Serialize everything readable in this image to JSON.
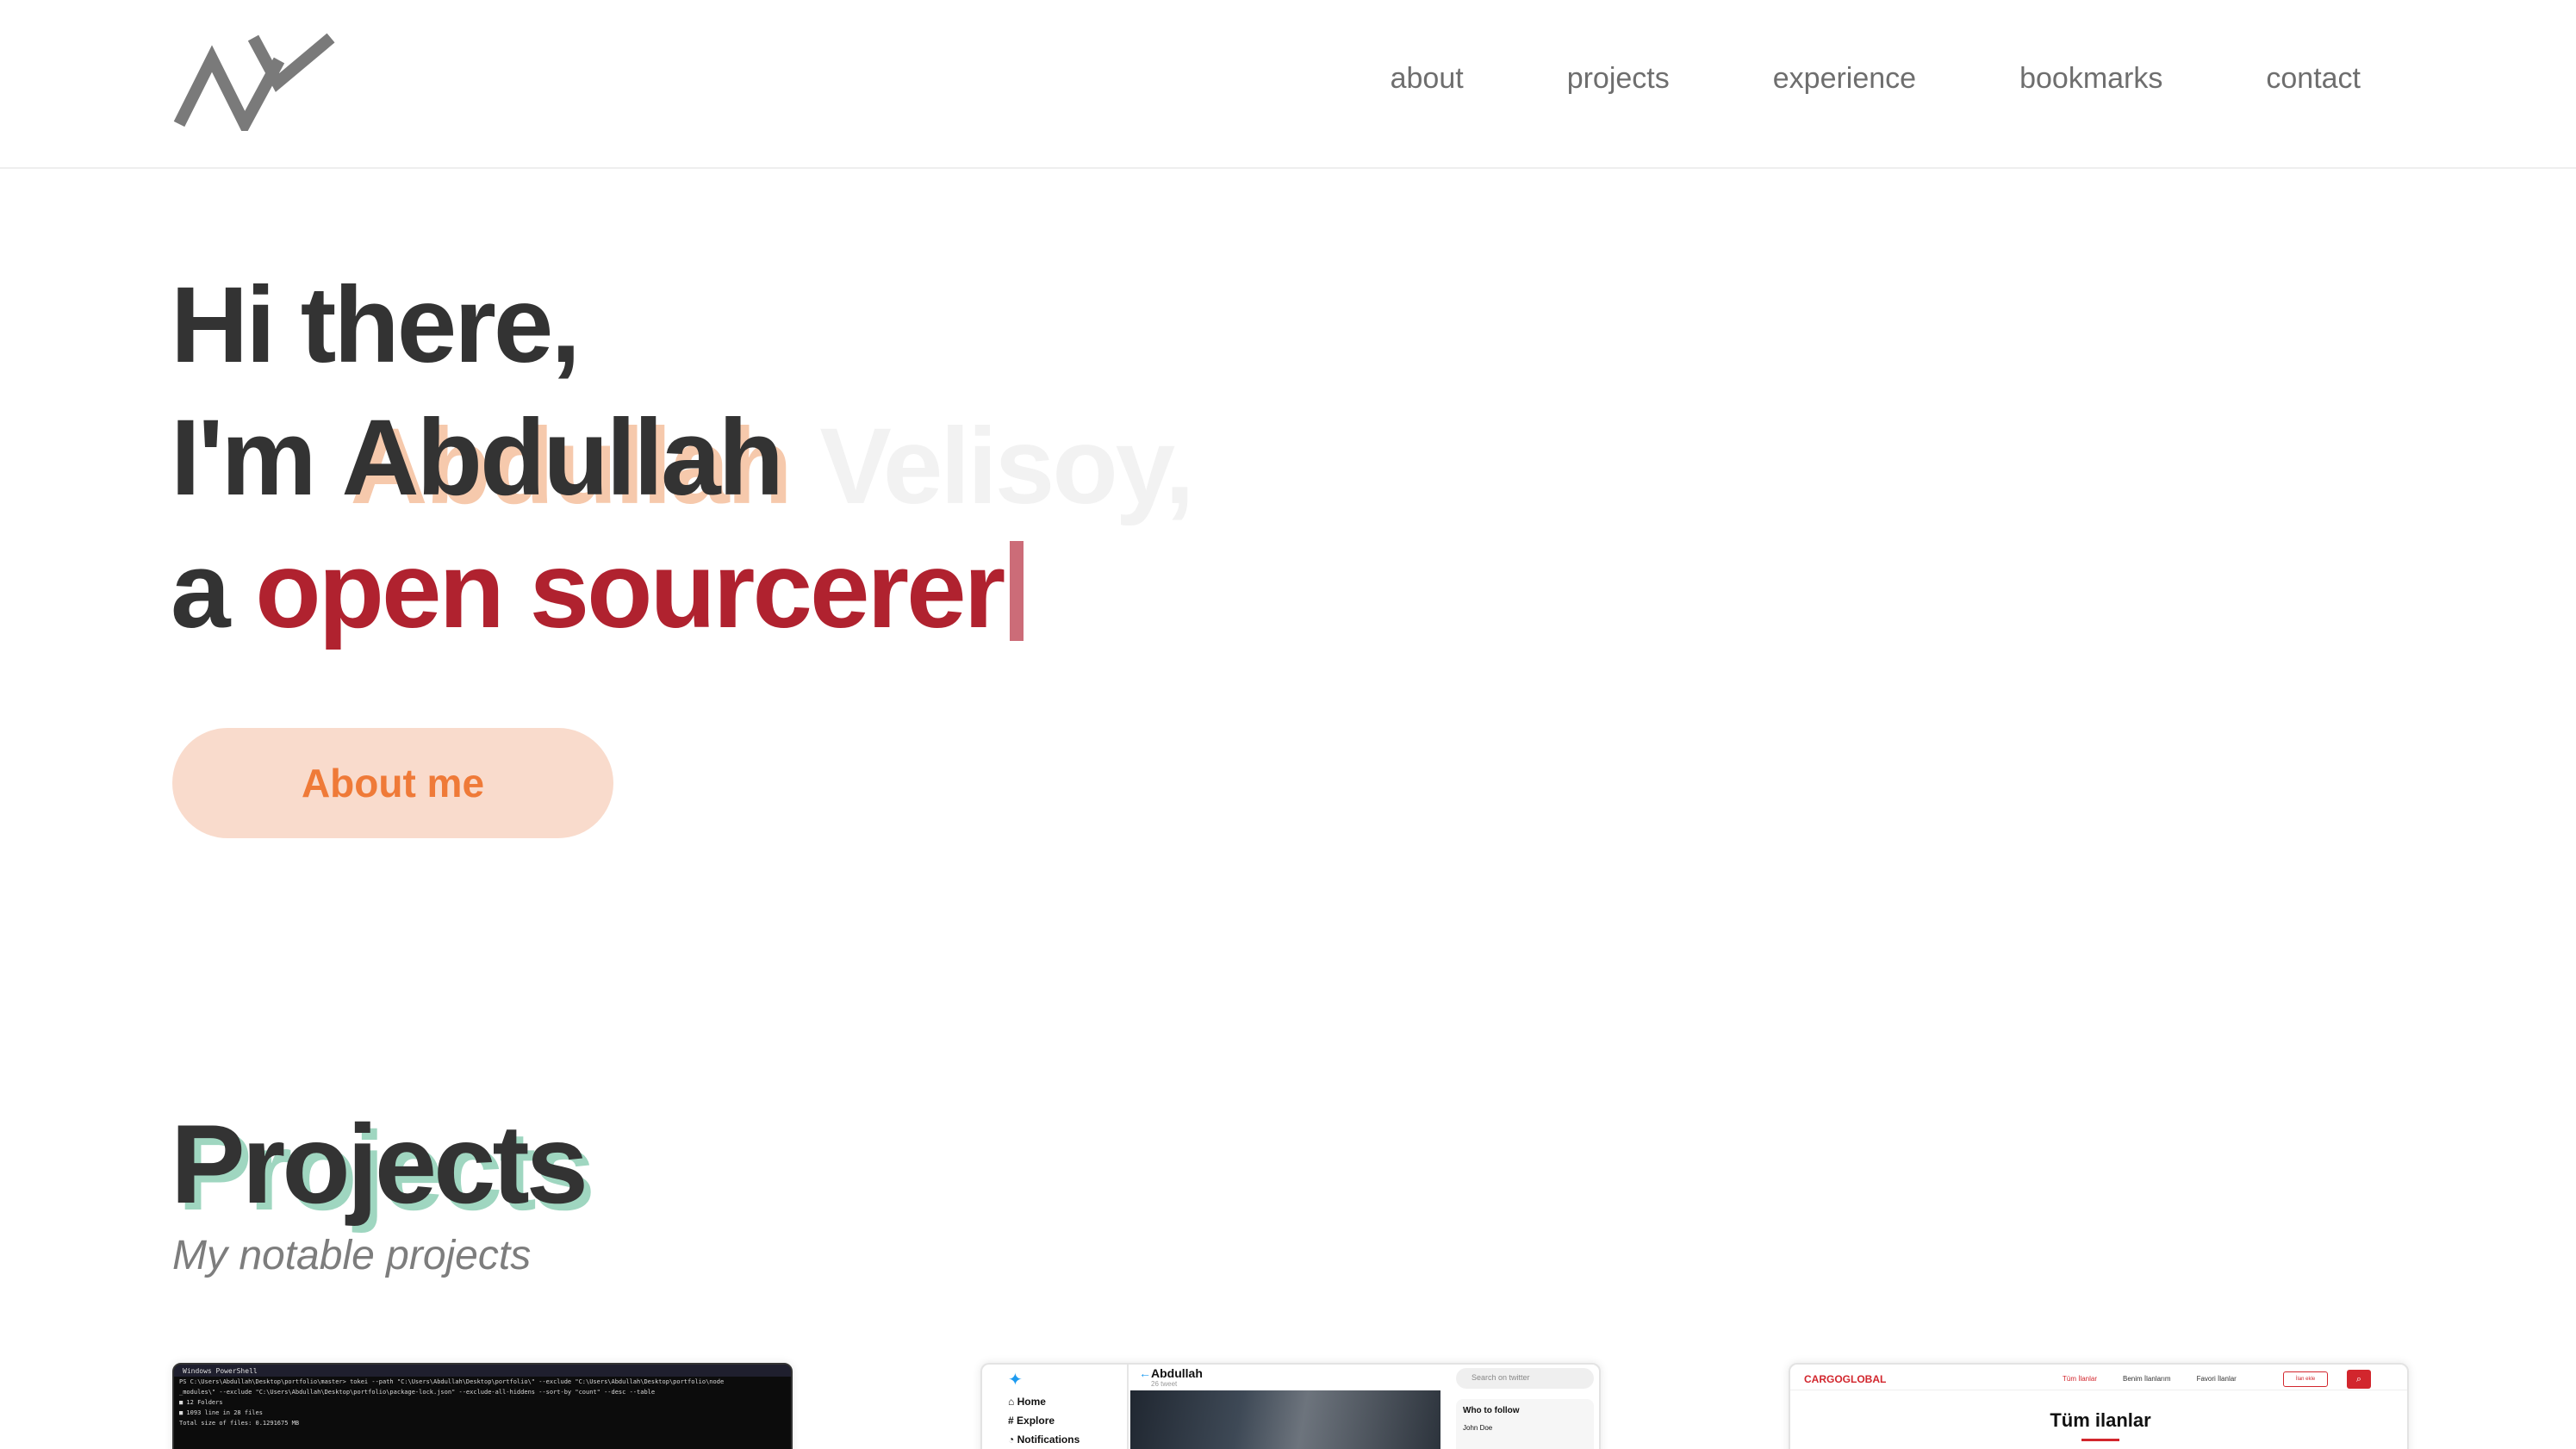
{
  "header": {
    "logo_name": "AV monogram logo",
    "nav": [
      "about",
      "projects",
      "experience",
      "bookmarks",
      "contact"
    ]
  },
  "hero": {
    "greeting": "Hi there,",
    "im": "I'm",
    "first_name": "Abdullah",
    "last_name": "Velisoy,",
    "article": "a",
    "role": "open sourcerer",
    "about_button": "About me"
  },
  "projects": {
    "title": "Projects",
    "subtitle": "My notable projects",
    "cards": [
      {
        "terminal_title": "Windows PowerShell",
        "lines": [
          "PS C:\\Users\\Abdullah\\Desktop\\portfolio\\master> tokei --path \"C:\\Users\\Abdullah\\Desktop\\portfolio\\\" --exclude \"C:\\Users\\Abdullah\\Desktop\\portfolio\\node",
          "_modules\\\" --exclude \"C:\\Users\\Abdullah\\Desktop\\portfolio\\package-lock.json\" --exclude-all-hiddens --sort-by \"count\" --desc --table",
          "■ 12 Folders",
          "■ 1093 line in 28 files",
          "Total size of files: 0.1291675 MB"
        ]
      },
      {
        "nav": [
          "Home",
          "Explore",
          "Notifications"
        ],
        "profile_name": "Abdullah",
        "profile_sub": "26 tweet",
        "search_placeholder": "Search on twitter",
        "who_to_follow": "Who to follow",
        "suggestion": "John Doe"
      },
      {
        "logo": "CARGOGLOBAL",
        "links": [
          "Tüm İlanlar",
          "Benim İlanlarım",
          "Favori İlanlar"
        ],
        "button": "İlan ekle",
        "title": "Tüm ilanlar"
      }
    ]
  },
  "colors": {
    "accent_red": "#b0222f",
    "button_bg": "#f9dbcc",
    "button_text": "#ef7a38",
    "ghost_name": "#f6c9ac",
    "projects_shadow": "#9fd6c0"
  }
}
